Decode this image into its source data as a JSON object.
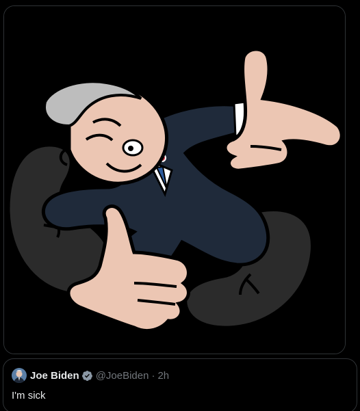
{
  "media": {
    "icon": "cartoon-image",
    "colors": {
      "background": "#000000",
      "suit": "#1f2a3a",
      "legs": "#2b2b2b",
      "skin": "#ecc6b3",
      "hair": "#bdbdbd",
      "tie": "#2c5a9c",
      "outline": "#000000"
    }
  },
  "quote": {
    "display_name": "Joe Biden",
    "handle": "@JoeBiden",
    "separator": "·",
    "time": "2h",
    "text": "I'm sick",
    "verified_icon": "verified-badge-icon",
    "colors": {
      "verified": "#8b98a5",
      "muted": "#71767b",
      "border": "#2f3336"
    }
  }
}
